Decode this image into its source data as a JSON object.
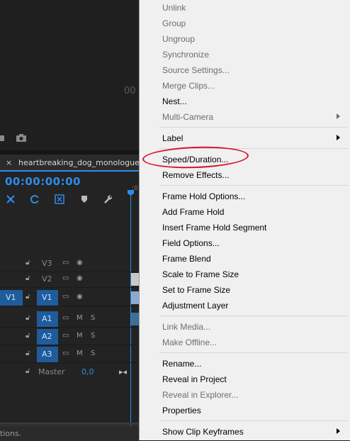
{
  "monitor": {
    "timecode_partial": "00"
  },
  "timeline": {
    "close_label": "×",
    "sequence_name": "heartbreaking_dog_monologue",
    "timecode": "00:00:00:00",
    "ruler_partial": ":0",
    "tracks": [
      {
        "source": "",
        "target": "V3",
        "t1": "",
        "t2": ""
      },
      {
        "source": "",
        "target": "V2",
        "t1": "",
        "t2": ""
      },
      {
        "source": "V1",
        "target": "V1",
        "t1": "",
        "t2": ""
      },
      {
        "source": "",
        "target": "A1",
        "t1": "M",
        "t2": "S"
      },
      {
        "source": "",
        "target": "A2",
        "t1": "M",
        "t2": "S"
      },
      {
        "source": "",
        "target": "A3",
        "t1": "M",
        "t2": "S"
      }
    ],
    "master_label": "Master",
    "master_value": "0,0",
    "status_partial": "tions."
  },
  "menu": {
    "items": [
      {
        "label": "Unlink",
        "disabled": true
      },
      {
        "label": "Group",
        "disabled": true
      },
      {
        "label": "Ungroup",
        "disabled": true
      },
      {
        "label": "Synchronize",
        "disabled": true
      },
      {
        "label": "Source Settings...",
        "disabled": true
      },
      {
        "label": "Merge Clips...",
        "disabled": true
      },
      {
        "label": "Nest...",
        "disabled": false
      },
      {
        "label": "Multi-Camera",
        "disabled": true,
        "submenu": true
      },
      {
        "label": "Label",
        "disabled": false,
        "submenu": true
      },
      {
        "label": "Speed/Duration...",
        "disabled": false
      },
      {
        "label": "Remove Effects...",
        "disabled": false
      },
      {
        "label": "Frame Hold Options...",
        "disabled": false
      },
      {
        "label": "Add Frame Hold",
        "disabled": false
      },
      {
        "label": "Insert Frame Hold Segment",
        "disabled": false
      },
      {
        "label": "Field Options...",
        "disabled": false
      },
      {
        "label": "Frame Blend",
        "disabled": false
      },
      {
        "label": "Scale to Frame Size",
        "disabled": false
      },
      {
        "label": "Set to Frame Size",
        "disabled": false
      },
      {
        "label": "Adjustment Layer",
        "disabled": false
      },
      {
        "label": "Link Media...",
        "disabled": true
      },
      {
        "label": "Make Offline...",
        "disabled": true
      },
      {
        "label": "Rename...",
        "disabled": false
      },
      {
        "label": "Reveal in Project",
        "disabled": false
      },
      {
        "label": "Reveal in Explorer...",
        "disabled": true
      },
      {
        "label": "Properties",
        "disabled": false
      },
      {
        "label": "Show Clip Keyframes",
        "disabled": false,
        "submenu": true
      }
    ]
  },
  "colors": {
    "accent": "#2d8ceb",
    "annotation_ring": "#d6162a",
    "menu_bg": "#f0f0f0"
  }
}
